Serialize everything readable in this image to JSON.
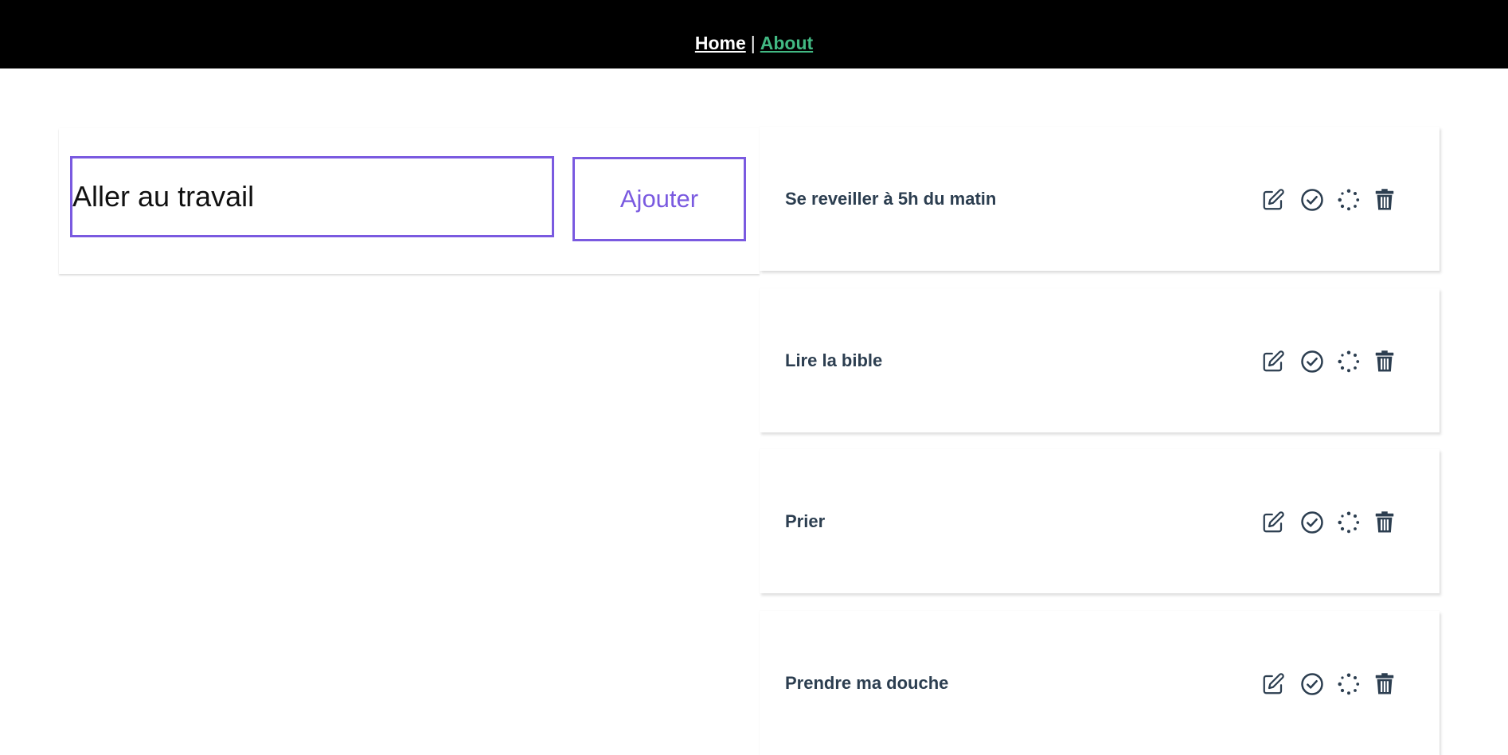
{
  "nav": {
    "home_label": "Home",
    "separator": "|",
    "about_label": "About",
    "about_color": "#42b983"
  },
  "form": {
    "input_value": "Aller au travail",
    "add_label": "Ajouter",
    "accent_color": "#7a5ae0"
  },
  "tasks": [
    {
      "label": "Se reveiller à 5h du matin"
    },
    {
      "label": "Lire la bible"
    },
    {
      "label": "Prier"
    },
    {
      "label": "Prendre ma douche"
    }
  ],
  "task_actions": [
    "edit-icon",
    "check-circle-icon",
    "spinner-icon",
    "trash-icon"
  ]
}
